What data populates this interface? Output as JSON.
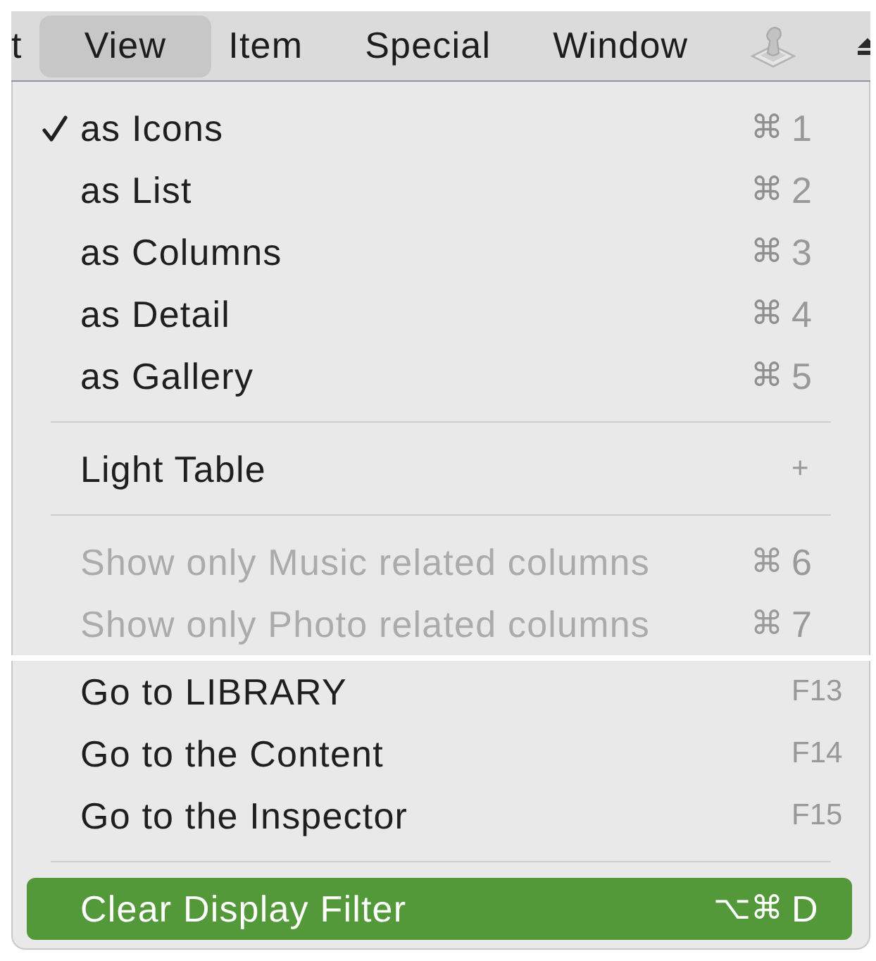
{
  "menu_bar": {
    "items": [
      {
        "label": "t",
        "selected": false
      },
      {
        "label": "View",
        "selected": true
      },
      {
        "label": "Item",
        "selected": false
      },
      {
        "label": "Special",
        "selected": false
      },
      {
        "label": "Window",
        "selected": false
      }
    ]
  },
  "menu": {
    "fragments": [
      {
        "sections": [
          {
            "items": [
              {
                "label": "as Icons",
                "modifiers": "⌘",
                "key": "1",
                "checked": true,
                "disabled": false,
                "highlighted": false
              },
              {
                "label": "as List",
                "modifiers": "⌘",
                "key": "2",
                "checked": false,
                "disabled": false,
                "highlighted": false
              },
              {
                "label": "as Columns",
                "modifiers": "⌘",
                "key": "3",
                "checked": false,
                "disabled": false,
                "highlighted": false
              },
              {
                "label": "as Detail",
                "modifiers": "⌘",
                "key": "4",
                "checked": false,
                "disabled": false,
                "highlighted": false
              },
              {
                "label": "as Gallery",
                "modifiers": "⌘",
                "key": "5",
                "checked": false,
                "disabled": false,
                "highlighted": false
              }
            ]
          },
          {
            "items": [
              {
                "label": "Light Table",
                "key": "+",
                "checked": false,
                "disabled": false,
                "highlighted": false
              }
            ]
          },
          {
            "items": [
              {
                "label": "Show only Music related columns",
                "modifiers": "⌘",
                "key": "6",
                "checked": false,
                "disabled": true,
                "highlighted": false
              },
              {
                "label": "Show only Photo related columns",
                "modifiers": "⌘",
                "key": "7",
                "checked": false,
                "disabled": true,
                "highlighted": false
              }
            ]
          }
        ]
      },
      {
        "sections": [
          {
            "items": [
              {
                "label": "Go to LIBRARY",
                "key": "F13",
                "checked": false,
                "disabled": false,
                "highlighted": false
              },
              {
                "label": "Go to the Content",
                "key": "F14",
                "checked": false,
                "disabled": false,
                "highlighted": false
              },
              {
                "label": "Go to the Inspector",
                "key": "F15",
                "checked": false,
                "disabled": false,
                "highlighted": false
              }
            ]
          },
          {
            "items": [
              {
                "label": "Clear Display Filter",
                "modifiers": "⌥⌘",
                "key": "D",
                "checked": false,
                "disabled": false,
                "highlighted": true
              }
            ]
          }
        ]
      }
    ]
  }
}
